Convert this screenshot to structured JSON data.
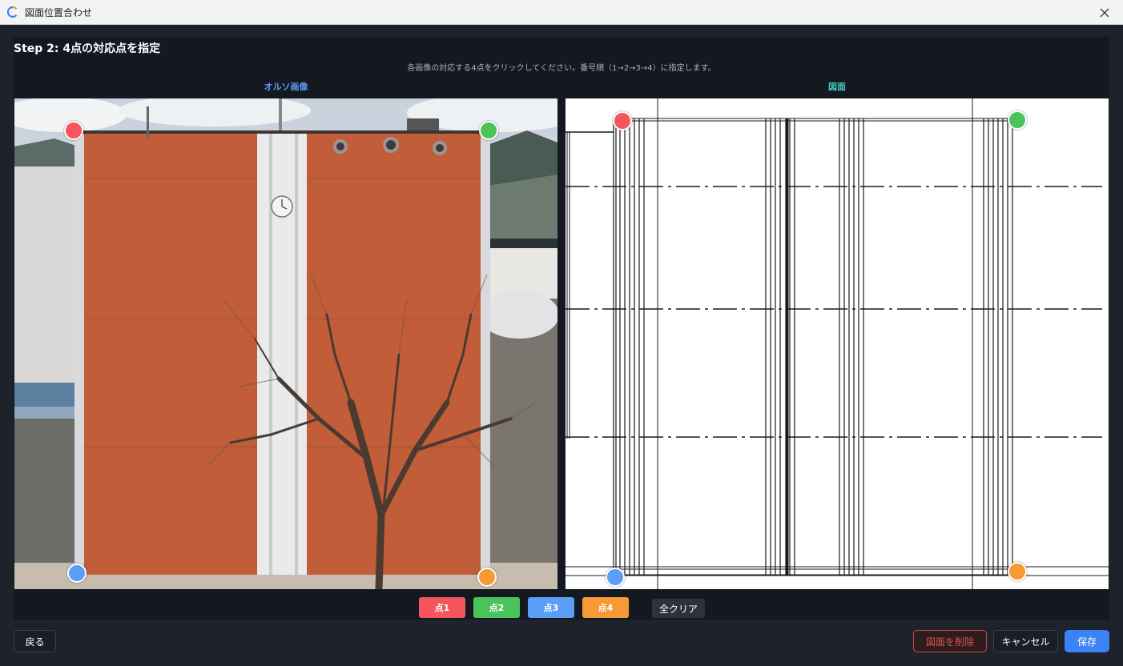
{
  "window": {
    "title": "図面位置合わせ",
    "icon": "app-logo-icon",
    "close_icon": "close-icon"
  },
  "step": {
    "title": "Step 2: 4点の対応点を指定",
    "instruction": "各画像の対応する4点をクリックしてください。番号順（1→2→3→4）に指定します。"
  },
  "images": {
    "ortho_label": "オルソ画像",
    "drawing_label": "図面"
  },
  "points": [
    {
      "label": "点1",
      "color": "#f5555d"
    },
    {
      "label": "点2",
      "color": "#4cc25a"
    },
    {
      "label": "点3",
      "color": "#5b9ef5"
    },
    {
      "label": "点4",
      "color": "#f79a33"
    }
  ],
  "clear_all_label": "全クリア",
  "footer": {
    "back_label": "戻る",
    "delete_label": "図面を削除",
    "cancel_label": "キャンセル",
    "save_label": "保存"
  },
  "colors": {
    "accent": "#3b82f6",
    "danger": "#d9443b",
    "ortho_label": "#5b9ef5",
    "drawing_label": "#40d0c7"
  }
}
